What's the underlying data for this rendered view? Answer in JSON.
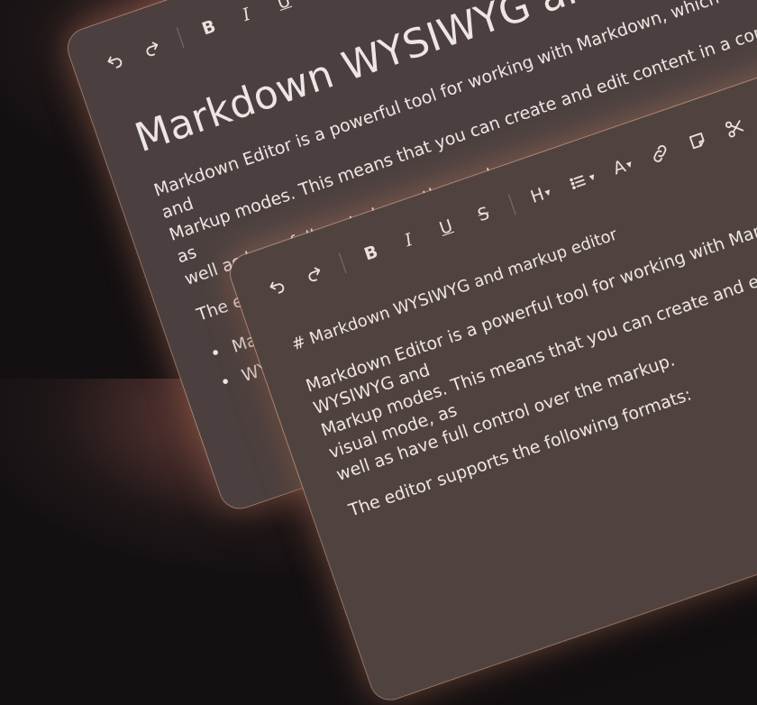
{
  "back_panel": {
    "title": "Markdown WYSIWYG and markup editor",
    "paragraph1": "Markdown Editor is a powerful tool for working with Markdown, which combines WYSIWYG and",
    "paragraph1_line2": "Markup modes. This means that you can create and edit content in a convenient visual mode, as",
    "paragraph1_line3": "well as have full control over the markup.",
    "paragraph2": "The editor supports the following formats:",
    "bullets": [
      "Markdown",
      "WYSIWYG"
    ]
  },
  "front_panel": {
    "heading_line": "# Markdown WYSIWYG and markup editor",
    "paragraph1": "Markdown Editor is a powerful tool for working with Markdown, which combines WYSIWYG and",
    "paragraph1_line2": "Markup modes. This means that you can create and edit content in a convenient visual mode, as",
    "paragraph1_line3": "well as have full control over the markup.",
    "paragraph2": "The editor supports the following formats:"
  },
  "toolbar": {
    "bold_label": "B",
    "italic_label": "I",
    "underline_label": "U",
    "strike_label": "S",
    "heading_label": "H",
    "font_label": "A",
    "icons": [
      "undo-icon",
      "redo-icon",
      "list-icon",
      "link-icon",
      "note-icon",
      "scissors-icon",
      "quote-icon",
      "code-icon"
    ]
  }
}
